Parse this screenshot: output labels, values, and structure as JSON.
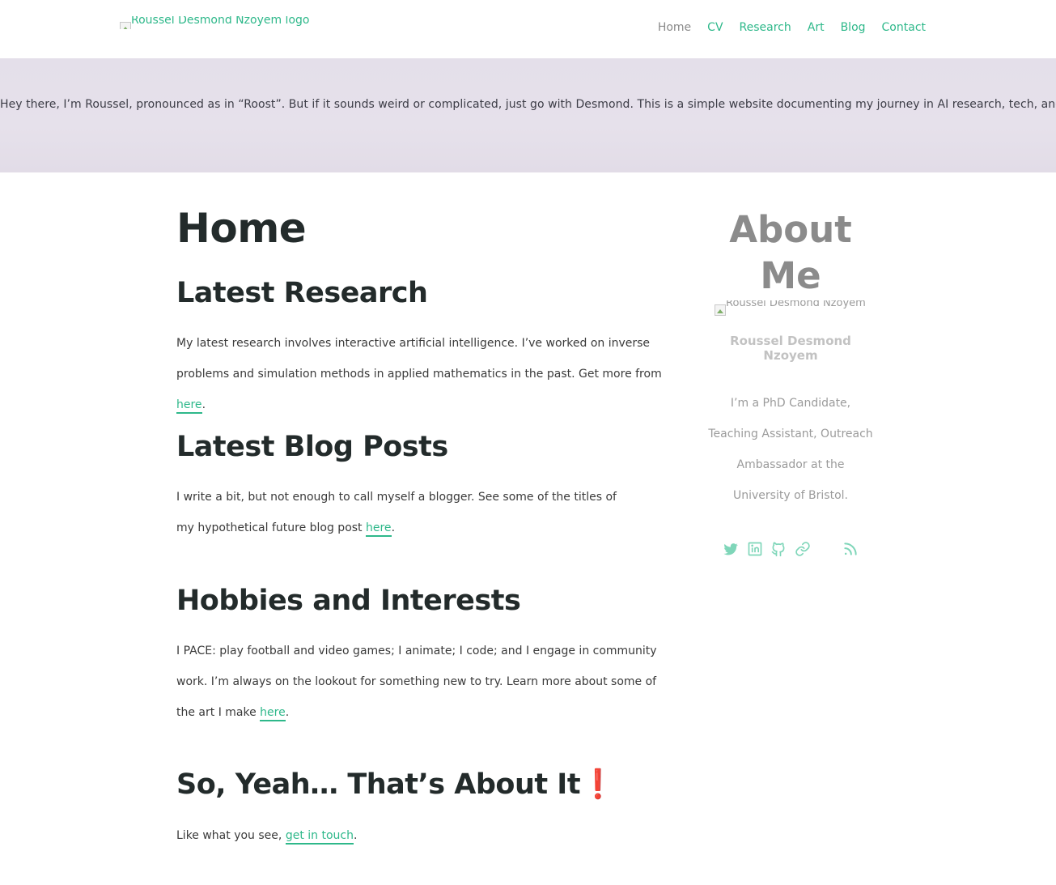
{
  "header": {
    "logo_alt": "Roussel Desmond Nzoyem logo",
    "nav": [
      {
        "label": "Home"
      },
      {
        "label": "CV"
      },
      {
        "label": "Research"
      },
      {
        "label": "Art"
      },
      {
        "label": "Blog"
      },
      {
        "label": "Contact"
      }
    ]
  },
  "hero": {
    "text": "Hey there, I’m Roussel, pronounced as in “Roost”. But if it sounds weird or complicated, just go with Desmond. This is a simple website documenting my journey in AI research, tech, and art."
  },
  "main": {
    "title": "Home",
    "sections": [
      {
        "heading": "Latest Research",
        "text": "My latest research involves interactive artificial intelligence. I’ve worked on inverse problems and simulation methods in applied mathematics in the past. Get more from ",
        "link": "here",
        "after": "."
      },
      {
        "heading": "Latest Blog Posts",
        "text": "I write a bit, but not enough to call myself a blogger. See some of the titles of my hypothetical future blog post ",
        "link": "here",
        "after": "."
      },
      {
        "heading": "Hobbies and Interests",
        "text": "I PACE: play football and video games; I animate; I code; and I engage in community work. I’m always on the lookout for something new to try. Learn more about some of the art I make ",
        "link": "here",
        "after": "."
      },
      {
        "heading": "So, Yeah… That’s About It❗",
        "text": "Like what you see, ",
        "link": "get in touch",
        "after": "."
      }
    ]
  },
  "sidebar": {
    "title": "About Me",
    "avatar_alt": "Roussel Desmond Nzoyem",
    "name": "Roussel Desmond Nzoyem",
    "bio": "I’m a PhD Candidate, Teaching Assistant, Outreach Ambassador at the University of Bristol.",
    "social": [
      "twitter-icon",
      "linkedin-icon",
      "github-icon",
      "link-icon",
      "email-icon",
      "rss-icon"
    ]
  },
  "colors": {
    "accent": "#2eb88a",
    "social": "#7fd6b9",
    "hero_bg": "#e5e0ea",
    "heading": "#232b2b"
  }
}
